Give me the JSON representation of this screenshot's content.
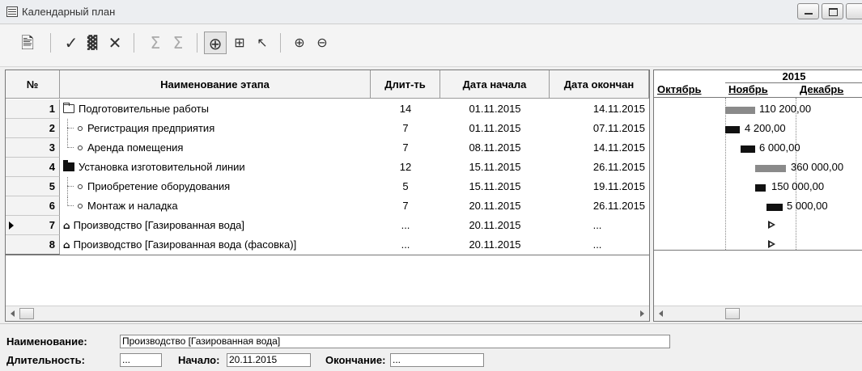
{
  "window": {
    "title": "Календарный план"
  },
  "toolbar": {
    "icons": [
      "properties-icon",
      "check-icon",
      "chart-icon",
      "delete-icon",
      "sum-down-icon",
      "sum-right-icon",
      "add-node-icon",
      "hierarchy-icon",
      "pointer-icon",
      "zoom-in-icon",
      "zoom-out-icon"
    ]
  },
  "grid": {
    "headers": {
      "num": "№",
      "name": "Наименование этапа",
      "duration": "Длит-ть",
      "start": "Дата начала",
      "end": "Дата окончан"
    },
    "rows": [
      {
        "num": "1",
        "name": "Подготовительные работы",
        "duration": "14",
        "start": "01.11.2015",
        "end": "14.11.2015"
      },
      {
        "num": "2",
        "name": "Регистрация предприятия",
        "duration": "7",
        "start": "01.11.2015",
        "end": "07.11.2015"
      },
      {
        "num": "3",
        "name": "Аренда помещения",
        "duration": "7",
        "start": "08.11.2015",
        "end": "14.11.2015"
      },
      {
        "num": "4",
        "name": "Установка изготовительной линии",
        "duration": "12",
        "start": "15.11.2015",
        "end": "26.11.2015"
      },
      {
        "num": "5",
        "name": "Приобретение оборудования",
        "duration": "5",
        "start": "15.11.2015",
        "end": "19.11.2015"
      },
      {
        "num": "6",
        "name": "Монтаж и наладка",
        "duration": "7",
        "start": "20.11.2015",
        "end": "26.11.2015"
      },
      {
        "num": "7",
        "name": "Производство [Газированная вода]",
        "duration": "...",
        "start": "20.11.2015",
        "end": "..."
      },
      {
        "num": "8",
        "name": "Производство [Газированная вода (фасовка)]",
        "duration": "...",
        "start": "20.11.2015",
        "end": "..."
      }
    ]
  },
  "gantt": {
    "year": "2015",
    "months": [
      "Октябрь",
      "Ноябрь",
      "Декабрь"
    ],
    "labels": [
      "110 200,00",
      "4 200,00",
      "6 000,00",
      "360 000,00",
      "150 000,00",
      "5 000,00"
    ]
  },
  "form": {
    "name_label": "Наименование:",
    "name_value": "Производство [Газированная вода]",
    "duration_label": "Длительность:",
    "duration_value": "...",
    "start_label": "Начало:",
    "start_value": "20.11.2015",
    "end_label": "Окончание:",
    "end_value": "..."
  }
}
